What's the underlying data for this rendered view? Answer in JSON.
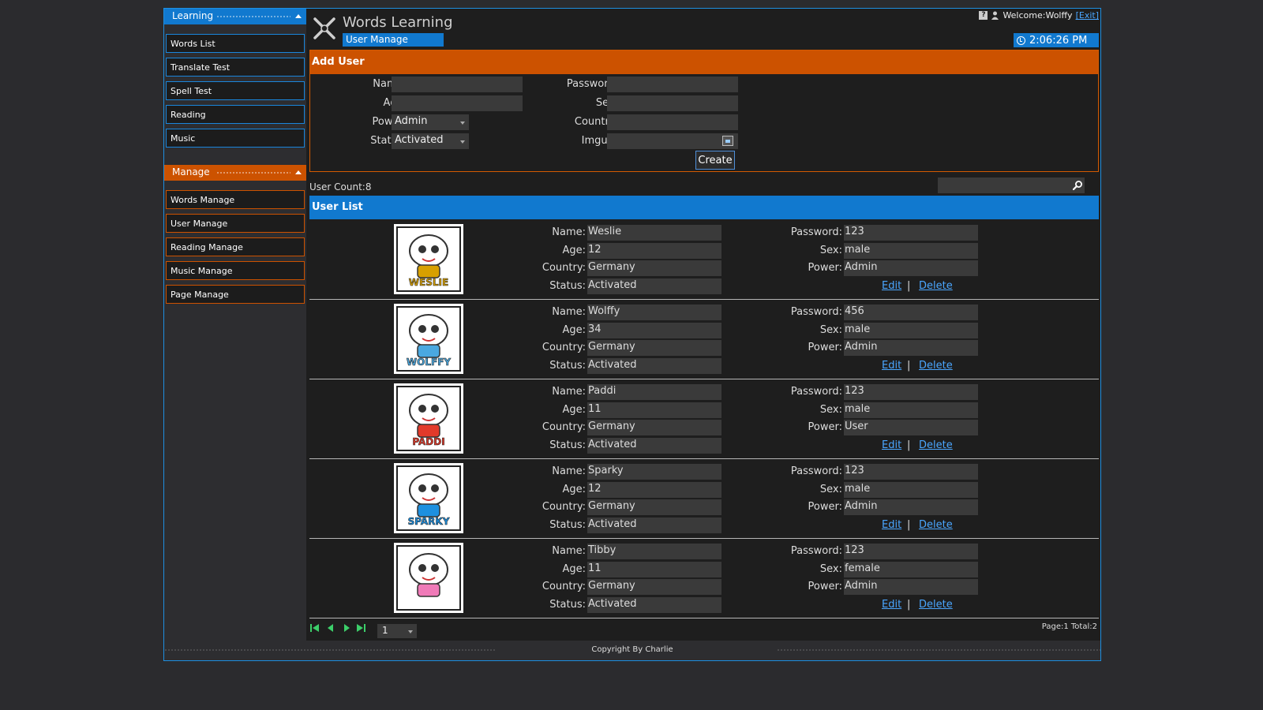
{
  "sidebar": {
    "learning_header": "Learning",
    "learning_items": [
      {
        "label": "Words List"
      },
      {
        "label": "Translate Test"
      },
      {
        "label": "Spell Test"
      },
      {
        "label": "Reading"
      },
      {
        "label": "Music"
      }
    ],
    "manage_header": "Manage",
    "manage_items": [
      {
        "label": "Words Manage"
      },
      {
        "label": "User Manage"
      },
      {
        "label": "Reading Manage"
      },
      {
        "label": "Music Manage"
      },
      {
        "label": "Page Manage"
      }
    ]
  },
  "header": {
    "app_title": "Words Learning",
    "breadcrumb": "User Manage",
    "welcome": "Welcome:Wolffy",
    "exit_label": "[Exit]",
    "clock": "2:06:26 PM",
    "help_icon": "help-icon",
    "user_icon": "user-icon",
    "clock_icon": "clock-icon"
  },
  "add_user": {
    "title": "Add User",
    "name_label": "Name:",
    "age_label": "Age:",
    "power_label": "Power:",
    "power_value": "Admin",
    "status_label": "Status:",
    "status_value": "Activated",
    "password_label": "Password:",
    "sex_label": "Sex:",
    "country_label": "Country:",
    "imgurl_label": "Imgurl:",
    "create_label": "Create"
  },
  "user_count": "User Count:8",
  "user_list": {
    "title": "User List",
    "labels": {
      "name": "Name:",
      "age": "Age:",
      "country": "Country:",
      "status": "Status:",
      "password": "Password:",
      "sex": "Sex:",
      "power": "Power:"
    },
    "edit_label": "Edit",
    "delete_label": "Delete",
    "separator": "|",
    "users": [
      {
        "name": "Weslie",
        "age": "12",
        "country": "Germany",
        "status": "Activated",
        "password": "123",
        "sex": "male",
        "power": "Admin",
        "avatar_text": "WESLIE",
        "avatar_color": "#d8a000"
      },
      {
        "name": "Wolffy",
        "age": "34",
        "country": "Germany",
        "status": "Activated",
        "password": "456",
        "sex": "male",
        "power": "Admin",
        "avatar_text": "WOLFFY",
        "avatar_color": "#4aa8e0"
      },
      {
        "name": "Paddi",
        "age": "11",
        "country": "Germany",
        "status": "Activated",
        "password": "123",
        "sex": "male",
        "power": "User",
        "avatar_text": "PADDI",
        "avatar_color": "#e23a2a"
      },
      {
        "name": "Sparky",
        "age": "12",
        "country": "Germany",
        "status": "Activated",
        "password": "123",
        "sex": "male",
        "power": "Admin",
        "avatar_text": "SPARKY",
        "avatar_color": "#1e90e0"
      },
      {
        "name": "Tibby",
        "age": "11",
        "country": "Germany",
        "status": "Activated",
        "password": "123",
        "sex": "female",
        "power": "Admin",
        "avatar_text": "",
        "avatar_color": "#f07ab8"
      }
    ]
  },
  "pager": {
    "page_select": "1",
    "info": "Page:1 Total:2"
  },
  "footer": {
    "copyright": "Copyright By Charlie"
  },
  "colors": {
    "accent_blue": "#1179cf",
    "accent_orange": "#cc5200",
    "link": "#4aa6ff"
  }
}
